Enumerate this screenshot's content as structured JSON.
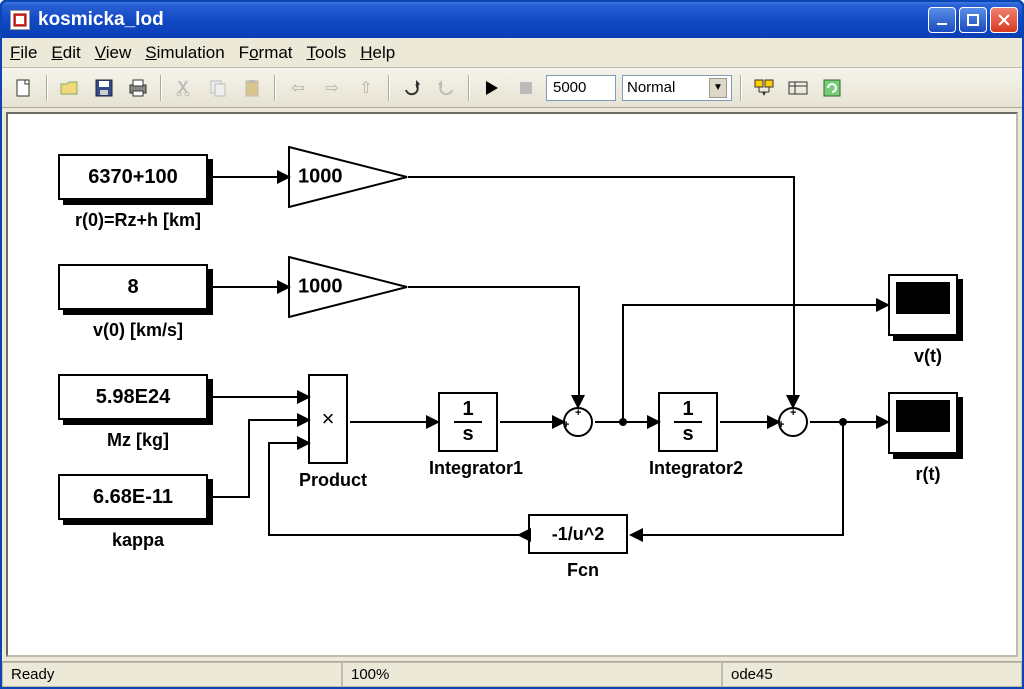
{
  "window": {
    "title": "kosmicka_lod"
  },
  "menu": {
    "file": "File",
    "edit": "Edit",
    "view": "View",
    "simulation": "Simulation",
    "format": "Format",
    "tools": "Tools",
    "help": "Help"
  },
  "toolbar": {
    "stop_time": "5000",
    "mode": "Normal"
  },
  "blocks": {
    "const1": {
      "value": "6370+100",
      "label": "r(0)=Rz+h [km]"
    },
    "const2": {
      "value": "8",
      "label": "v(0) [km/s]"
    },
    "const3": {
      "value": "5.98E24",
      "label": "Mz [kg]"
    },
    "const4": {
      "value": "6.68E-11",
      "label": "kappa"
    },
    "gain1": {
      "value": "1000"
    },
    "gain2": {
      "value": "1000"
    },
    "product": {
      "symbol": "×",
      "label": "Product"
    },
    "int1": {
      "num": "1",
      "den": "s",
      "label": "Integrator1"
    },
    "int2": {
      "num": "1",
      "den": "s",
      "label": "Integrator2"
    },
    "fcn": {
      "expr": "-1/u^2",
      "label": "Fcn"
    },
    "scope1": {
      "label": "v(t)"
    },
    "scope2": {
      "label": "r(t)"
    }
  },
  "status": {
    "state": "Ready",
    "zoom": "100%",
    "solver": "ode45"
  }
}
